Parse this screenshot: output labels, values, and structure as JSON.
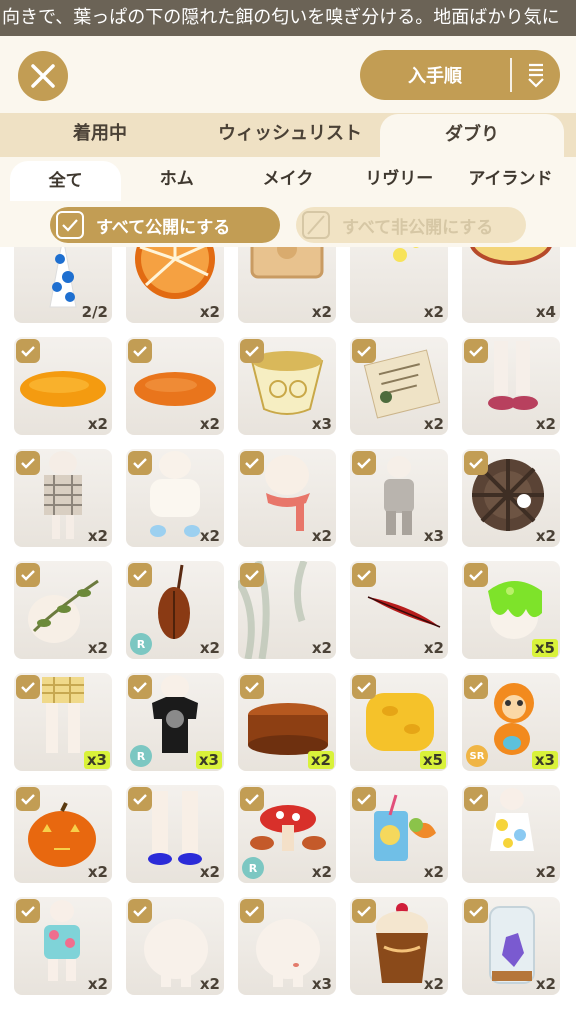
{
  "ticker": {
    "text": "向きで、葉っぱの下の隠れた餌の匂いを嗅ぎ分ける。地面ばかり気に"
  },
  "header": {
    "sort_label": "入手順"
  },
  "tabs_primary": [
    "着用中",
    "ウィッシュリスト",
    "ダブり"
  ],
  "tabs_secondary": [
    "全て",
    "ホム",
    "メイク",
    "リヴリー",
    "アイランド"
  ],
  "actions": {
    "public_label": "すべて公開にする",
    "private_label": "すべて非公開にする"
  },
  "colors": {
    "accent": "#c29d54",
    "tab_bg": "#efe1c4",
    "badge_new": "#d9f23a",
    "rarity_r": "#7cc7c2",
    "rarity_sr": "#f0b545"
  },
  "items": [
    {
      "icon": "party-hat",
      "count": "2/2",
      "checked": false
    },
    {
      "icon": "orange-slice",
      "count": "x2",
      "checked": false
    },
    {
      "icon": "biscuit",
      "count": "x2",
      "checked": false
    },
    {
      "icon": "flowers",
      "count": "x2",
      "checked": false
    },
    {
      "icon": "plate",
      "count": "x4",
      "checked": false
    },
    {
      "icon": "orange-rug",
      "count": "x2",
      "checked": true
    },
    {
      "icon": "orange-rug-2",
      "count": "x2",
      "checked": true
    },
    {
      "icon": "teacup",
      "count": "x3",
      "checked": true
    },
    {
      "icon": "letter",
      "count": "x2",
      "checked": true
    },
    {
      "icon": "pink-shoes",
      "count": "x2",
      "checked": true
    },
    {
      "icon": "plaid-outfit",
      "count": "x2",
      "checked": true
    },
    {
      "icon": "white-sweater",
      "count": "x2",
      "checked": true
    },
    {
      "icon": "red-scarf",
      "count": "x2",
      "checked": true
    },
    {
      "icon": "grey-outfit",
      "count": "x3",
      "checked": true
    },
    {
      "icon": "water-wheel",
      "count": "x2",
      "checked": true
    },
    {
      "icon": "leaf-vine",
      "count": "x2",
      "checked": true
    },
    {
      "icon": "cello",
      "count": "x2",
      "checked": true,
      "rarity": "R"
    },
    {
      "icon": "moss",
      "count": "x2",
      "checked": true
    },
    {
      "icon": "red-feather",
      "count": "x2",
      "checked": true
    },
    {
      "icon": "green-slime",
      "count": "x5",
      "checked": true,
      "new": true
    },
    {
      "icon": "plaid-shorts",
      "count": "x3",
      "checked": true,
      "new": true
    },
    {
      "icon": "black-tshirt",
      "count": "x3",
      "checked": true,
      "new": true,
      "rarity": "R"
    },
    {
      "icon": "wood-table",
      "count": "x2",
      "checked": true,
      "new": true
    },
    {
      "icon": "yellow-rug",
      "count": "x5",
      "checked": true,
      "new": true
    },
    {
      "icon": "monkey-plush",
      "count": "x3",
      "checked": true,
      "new": true,
      "rarity": "SR"
    },
    {
      "icon": "pumpkin",
      "count": "x2",
      "checked": true
    },
    {
      "icon": "white-socks",
      "count": "x2",
      "checked": true
    },
    {
      "icon": "mushroom-table",
      "count": "x2",
      "checked": true,
      "rarity": "R"
    },
    {
      "icon": "tropical-drink",
      "count": "x2",
      "checked": true
    },
    {
      "icon": "flower-dress",
      "count": "x2",
      "checked": true
    },
    {
      "icon": "floral-shirt",
      "count": "x2",
      "checked": true
    },
    {
      "icon": "bald-head",
      "count": "x2",
      "checked": true
    },
    {
      "icon": "head-lips",
      "count": "x3",
      "checked": true
    },
    {
      "icon": "cupcake-jar",
      "count": "x2",
      "checked": true
    },
    {
      "icon": "crystal-jar",
      "count": "x2",
      "checked": true
    }
  ]
}
